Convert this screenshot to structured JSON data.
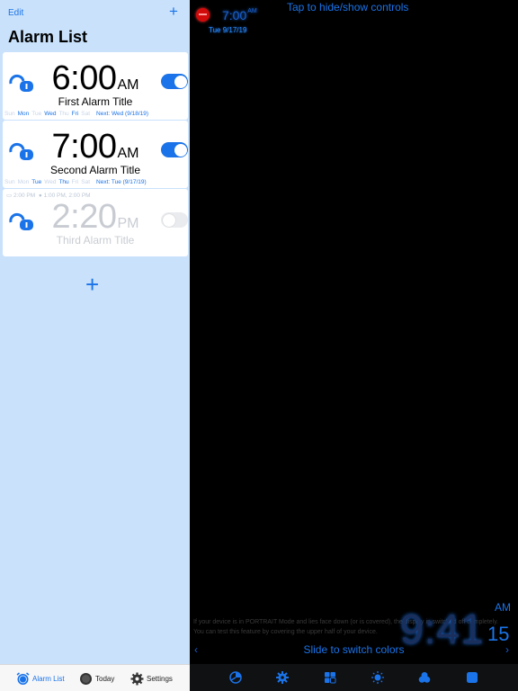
{
  "left": {
    "nav": {
      "edit": "Edit",
      "add": "+"
    },
    "title": "Alarm List",
    "alarms": [
      {
        "time": "6:00",
        "ampm": "AM",
        "title": "First Alarm Title",
        "enabled": true,
        "days": [
          "Sun",
          "Mon",
          "Tue",
          "Wed",
          "Thu",
          "Fri",
          "Sat"
        ],
        "active_days": [
          "Mon",
          "Wed",
          "Fri"
        ],
        "next": "Next: Wed (9/18/19)"
      },
      {
        "time": "7:00",
        "ampm": "AM",
        "title": "Second Alarm Title",
        "enabled": true,
        "days": [
          "Sun",
          "Mon",
          "Tue",
          "Wed",
          "Thu",
          "Fri",
          "Sat"
        ],
        "active_days": [
          "Tue",
          "Thu"
        ],
        "next": "Next: Tue (9/17/19)"
      },
      {
        "time": "2:20",
        "ampm": "PM",
        "title": "Third Alarm Title",
        "enabled": false,
        "snooze1": "2:00 PM",
        "snooze2": "1:00 PM, 2:00 PM"
      }
    ],
    "add_big": "+",
    "tabs": [
      {
        "label": "Alarm List",
        "icon": "alarm-clock-icon",
        "active": true
      },
      {
        "label": "Today",
        "icon": "today-icon",
        "active": false
      },
      {
        "label": "Settings",
        "icon": "gear-icon",
        "active": false
      }
    ]
  },
  "right": {
    "mini_time": "7:00",
    "mini_ampm": "AM",
    "mini_date": "Tue 9/17/19",
    "hint_top": "Tap to hide/show controls",
    "hint_portrait": "If your device is in PORTRAIT Mode and lies face down (or is covered), the display is switched off completely. You can test this feature by covering the upper half of your device.",
    "clock": "9:41",
    "clock_ampm": "AM",
    "clock_seconds": "15",
    "slide_hint": "Slide to switch colors",
    "chevron_left": "‹",
    "chevron_right": "›",
    "tools": [
      "pie-chart-icon",
      "gear-icon",
      "grid-icon",
      "brightness-icon",
      "color-circles-icon",
      "square-icon"
    ]
  },
  "colors": {
    "accent": "#1a73e8",
    "left_bg": "#c9e1fb",
    "right_bg": "#000000"
  }
}
